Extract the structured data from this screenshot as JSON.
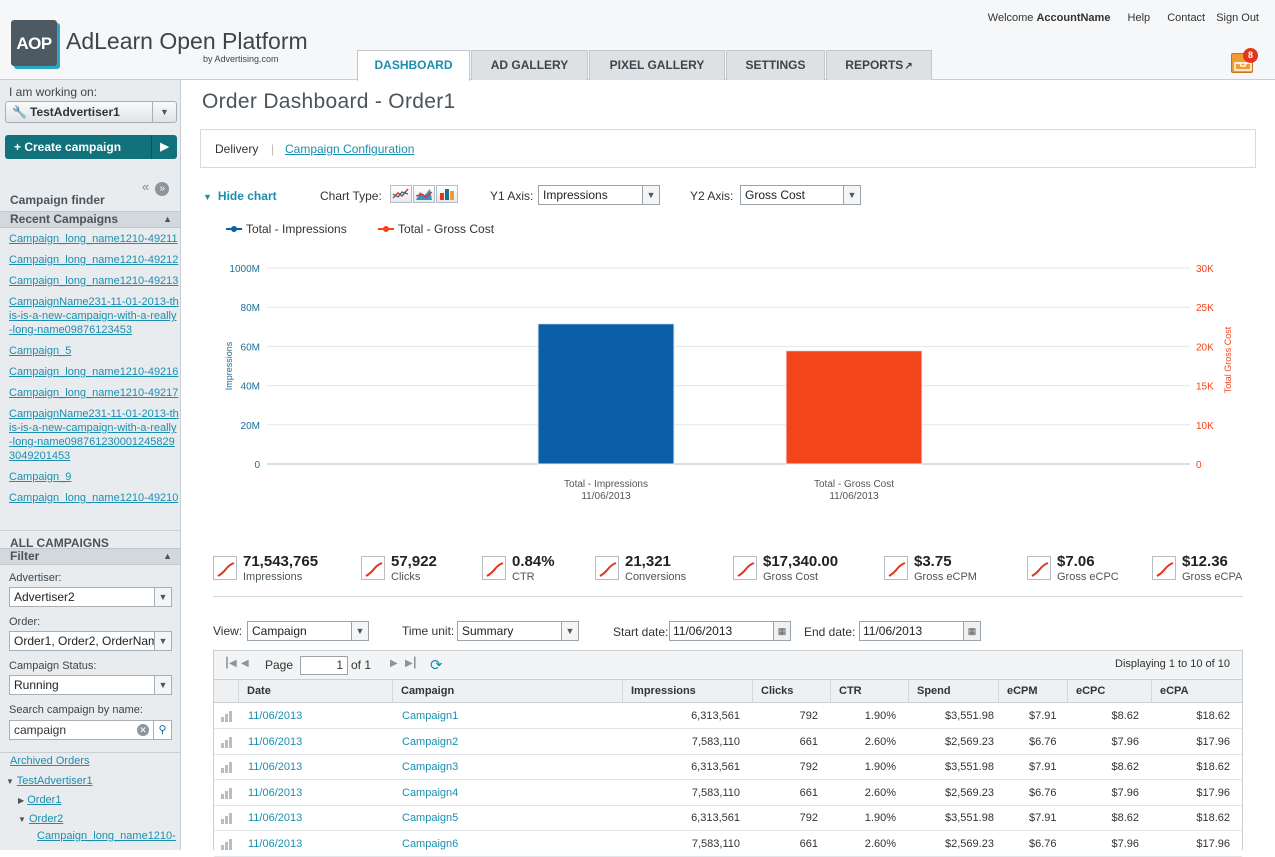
{
  "header": {
    "logo_text": "AOP",
    "brand_name": "AdLearn Open Platform",
    "brand_sub": "by Advertising.com",
    "welcome": "Welcome",
    "account_name": "AccountName",
    "links": [
      "Help",
      "Contact",
      "Sign Out"
    ],
    "tabs": [
      "DASHBOARD",
      "AD GALLERY",
      "PIXEL GALLERY",
      "SETTINGS",
      "REPORTS"
    ],
    "active_tab": "DASHBOARD",
    "notification_count": "8"
  },
  "sidebar": {
    "working_on_label": "I am working on:",
    "advertiser": "TestAdvertiser1",
    "create_label": "+ Create campaign",
    "campaign_finder": "Campaign finder",
    "recent_heading": "Recent Campaigns",
    "recent": [
      "Campaign_long_name1210-49211",
      "Campaign_long_name1210-49212",
      "Campaign_long_name1210-49213",
      "CampaignName231-11-01-2013-this-is-a-new-campaign-with-a-really-long-name09876123453",
      "Campaign_5",
      "Campaign_long_name1210-49216",
      "Campaign_long_name1210-49217",
      "CampaignName231-11-01-2013-this-is-a-new-campaign-with-a-really-long-name0987612300012458293049201453",
      "Campaign_9",
      "Campaign_long_name1210-49210"
    ],
    "all_campaigns": "ALL CAMPAIGNS",
    "filter_heading": "Filter",
    "advertiser_label": "Advertiser:",
    "advertiser_value": "Advertiser2",
    "order_label": "Order:",
    "order_value": "Order1, Order2, OrderNam",
    "status_label": "Campaign Status:",
    "status_value": "Running",
    "search_label": "Search campaign by name:",
    "search_value": "campaign",
    "archived": "Archived Orders",
    "tree": {
      "root": "TestAdvertiser1",
      "order1": "Order1",
      "order2": "Order2",
      "child": "Campaign_long_name1210-"
    }
  },
  "main": {
    "title": "Order Dashboard - Order1",
    "subtabs": {
      "delivery": "Delivery",
      "config": "Campaign Configuration"
    },
    "hide_chart": "Hide chart",
    "chart_type_label": "Chart Type:",
    "y1_label": "Y1 Axis:",
    "y1_value": "Impressions",
    "y2_label": "Y2 Axis:",
    "y2_value": "Gross Cost"
  },
  "chart_data": {
    "type": "bar",
    "categories": [
      "Total - Impressions",
      "Total - Gross Cost"
    ],
    "category_sub": [
      "11/06/2013",
      "11/06/2013"
    ],
    "series": [
      {
        "name": "Total - Impressions",
        "axis": "y1",
        "category_index": 0,
        "value": 71543765,
        "color": "#0b5ea8"
      },
      {
        "name": "Total - Gross Cost",
        "axis": "y2",
        "category_index": 1,
        "value": 17340,
        "color": "#f4441c"
      }
    ],
    "y1": {
      "label": "Impressions",
      "ticks": [
        "0",
        "20M",
        "40M",
        "60M",
        "80M",
        "1000M"
      ],
      "tick_values": [
        0,
        20000000,
        40000000,
        60000000,
        80000000,
        100000000
      ],
      "ylim": [
        0,
        100000000
      ],
      "color": "#1a6f96"
    },
    "y2": {
      "label": "Total Gross Cost",
      "ticks": [
        "0",
        "10K",
        "15K",
        "20K",
        "25K",
        "30K"
      ],
      "tick_values": [
        0,
        6000,
        12000,
        18000,
        24000,
        30000
      ],
      "ylim": [
        0,
        30000
      ],
      "color": "#f4441c"
    },
    "grid": true,
    "legend_position": "top-left"
  },
  "metrics": [
    {
      "value": "71,543,765",
      "label": "Impressions"
    },
    {
      "value": "57,922",
      "label": "Clicks"
    },
    {
      "value": "0.84%",
      "label": "CTR"
    },
    {
      "value": "21,321",
      "label": "Conversions"
    },
    {
      "value": "$17,340.00",
      "label": "Gross Cost"
    },
    {
      "value": "$3.75",
      "label": "Gross eCPM"
    },
    {
      "value": "$7.06",
      "label": "Gross eCPC"
    },
    {
      "value": "$12.36",
      "label": "Gross eCPA"
    }
  ],
  "table_controls": {
    "view_label": "View:",
    "view_value": "Campaign",
    "time_unit_label": "Time unit:",
    "time_unit_value": "Summary",
    "start_label": "Start date:",
    "start_value": "11/06/2013",
    "end_label": "End date:",
    "end_value": "11/06/2013",
    "page_label": "Page",
    "page_value": "1",
    "page_of": "of 1",
    "displaying": "Displaying 1 to 10  of 10"
  },
  "table": {
    "columns": [
      "Date",
      "Campaign",
      "Impressions",
      "Clicks",
      "CTR",
      "Spend",
      "eCPM",
      "eCPC",
      "eCPA"
    ],
    "rows": [
      [
        "11/06/2013",
        "Campaign1",
        "6,313,561",
        "792",
        "1.90%",
        "$3,551.98",
        "$7.91",
        "$8.62",
        "$18.62"
      ],
      [
        "11/06/2013",
        "Campaign2",
        "7,583,110",
        "661",
        "2.60%",
        "$2,569.23",
        "$6.76",
        "$7.96",
        "$17.96"
      ],
      [
        "11/06/2013",
        "Campaign3",
        "6,313,561",
        "792",
        "1.90%",
        "$3,551.98",
        "$7.91",
        "$8.62",
        "$18.62"
      ],
      [
        "11/06/2013",
        "Campaign4",
        "7,583,110",
        "661",
        "2.60%",
        "$2,569.23",
        "$6.76",
        "$7.96",
        "$17.96"
      ],
      [
        "11/06/2013",
        "Campaign5",
        "6,313,561",
        "792",
        "1.90%",
        "$3,551.98",
        "$7.91",
        "$8.62",
        "$18.62"
      ],
      [
        "11/06/2013",
        "Campaign6",
        "7,583,110",
        "661",
        "2.60%",
        "$2,569.23",
        "$6.76",
        "$7.96",
        "$17.96"
      ]
    ]
  }
}
